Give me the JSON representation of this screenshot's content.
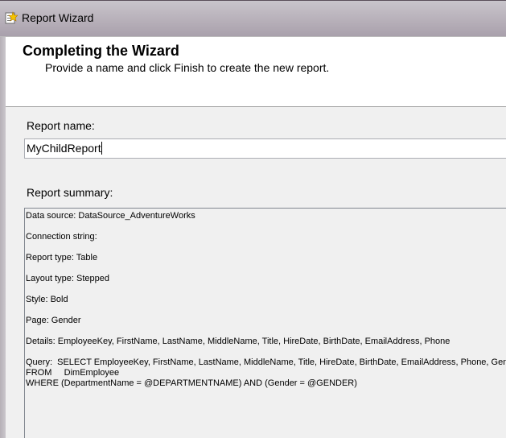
{
  "window": {
    "title": "Report Wizard",
    "icon": "report-wizard-icon"
  },
  "header": {
    "heading": "Completing the Wizard",
    "subheading": "Provide a name and click Finish to create the new report."
  },
  "form": {
    "report_name_label": "Report name:",
    "report_name_value": "MyChildReport",
    "report_summary_label": "Report summary:"
  },
  "summary": {
    "data_source": "Data source: DataSource_AdventureWorks",
    "connection_string": "Connection string:",
    "report_type": "Report type: Table",
    "layout_type": "Layout type: Stepped",
    "style": "Style: Bold",
    "page": "Page: Gender",
    "details": "Details: EmployeeKey, FirstName, LastName, MiddleName, Title, HireDate, BirthDate, EmailAddress, Phone",
    "query_line1": "Query:  SELECT EmployeeKey, FirstName, LastName, MiddleName, Title, HireDate, BirthDate, EmailAddress, Phone, Gender",
    "query_line2": "FROM     DimEmployee",
    "query_line3": "WHERE (DepartmentName = @DEPARTMENTNAME) AND (Gender = @GENDER)"
  }
}
